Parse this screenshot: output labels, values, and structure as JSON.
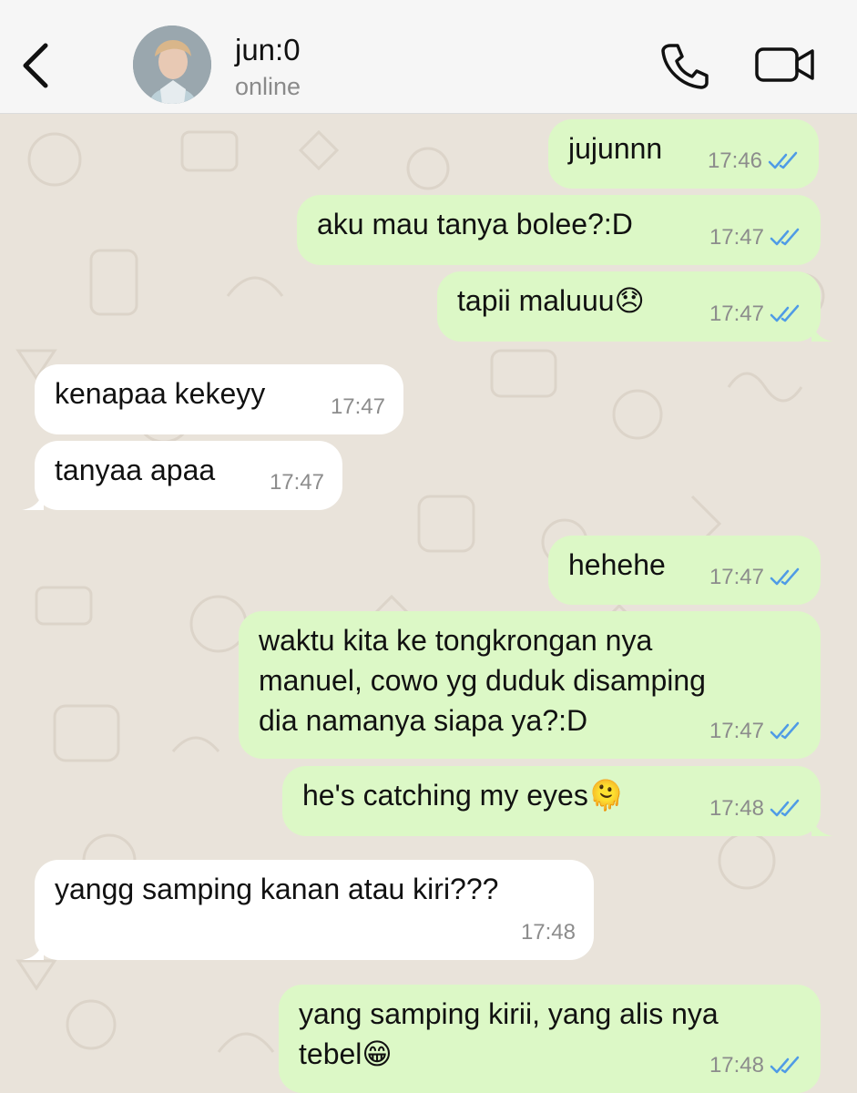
{
  "header": {
    "contact_name": "jun:0",
    "status": "online"
  },
  "messages": [
    {
      "direction": "outgoing",
      "text": "jujunnn",
      "time": "17:46",
      "read": true
    },
    {
      "direction": "outgoing",
      "text": "aku mau tanya bolee?:D",
      "time": "17:47",
      "read": true
    },
    {
      "direction": "outgoing",
      "text": "tapii maluuu😞",
      "time": "17:47",
      "read": true
    },
    {
      "direction": "incoming",
      "text": "kenapaa kekeyy",
      "time": "17:47"
    },
    {
      "direction": "incoming",
      "text": "tanyaa apaa",
      "time": "17:47"
    },
    {
      "direction": "outgoing",
      "text": "hehehe",
      "time": "17:47",
      "read": true
    },
    {
      "direction": "outgoing",
      "text": "waktu kita ke tongkrongan nya\nmanuel, cowo yg duduk disamping\ndia namanya siapa ya?:D",
      "time": "17:47",
      "read": true
    },
    {
      "direction": "outgoing",
      "text": "he's catching my eyes🫠",
      "time": "17:48",
      "read": true
    },
    {
      "direction": "incoming",
      "text": "yangg samping kanan atau kiri???",
      "time": "17:48"
    },
    {
      "direction": "outgoing",
      "text": "yang samping kirii, yang alis nya\ntebel😁",
      "time": "17:48",
      "read": true
    }
  ],
  "colors": {
    "outgoing_bubble": "#dcf8c6",
    "incoming_bubble": "#ffffff",
    "read_ticks": "#4f9be6",
    "wallpaper": "#e9e3da"
  }
}
